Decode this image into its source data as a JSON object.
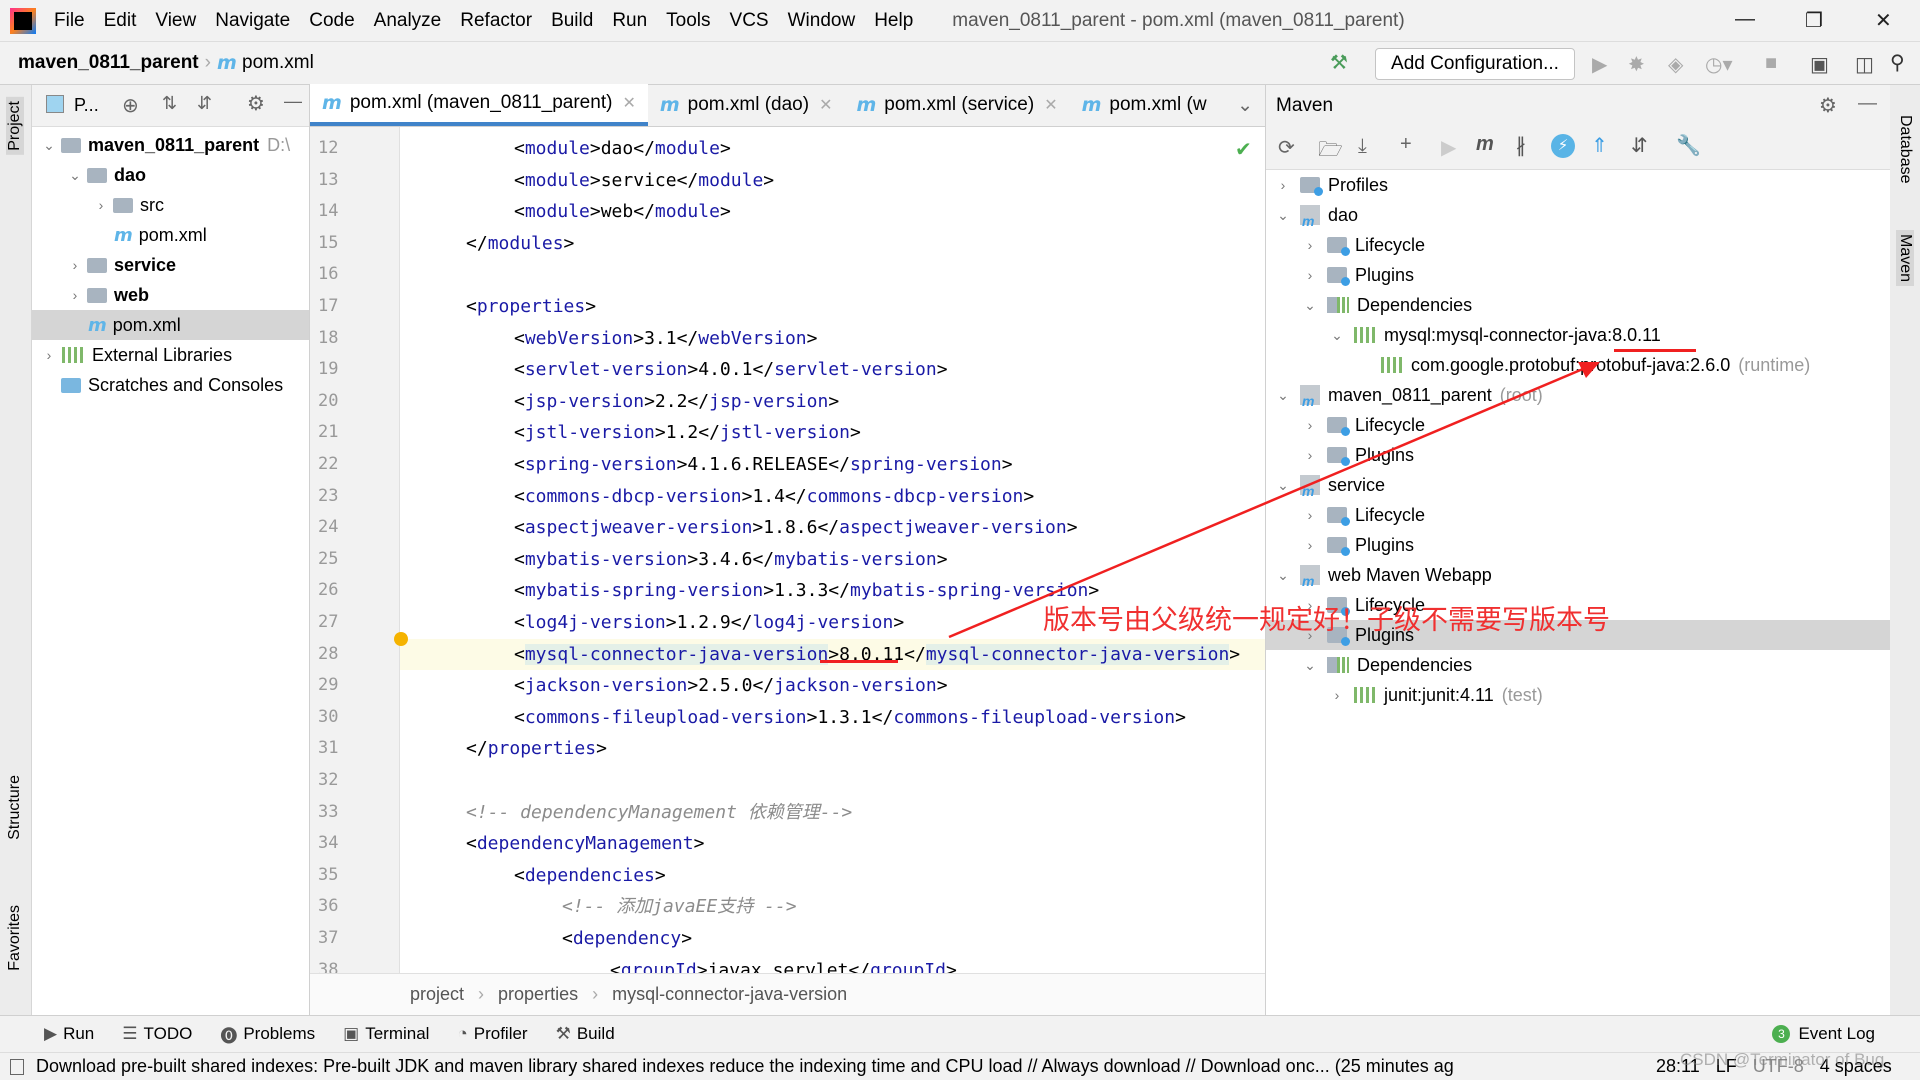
{
  "menubar": {
    "items": [
      "File",
      "Edit",
      "View",
      "Navigate",
      "Code",
      "Analyze",
      "Refactor",
      "Build",
      "Run",
      "Tools",
      "VCS",
      "Window",
      "Help"
    ],
    "title": "maven_0811_parent - pom.xml (maven_0811_parent)"
  },
  "navbar": {
    "project": "maven_0811_parent",
    "file": "pom.xml",
    "add_configuration": "Add Configuration..."
  },
  "left_stripe": {
    "project": "Project",
    "structure": "Structure",
    "favorites": "Favorites"
  },
  "right_stripe": {
    "database": "Database",
    "maven": "Maven"
  },
  "project_panel": {
    "title": "P...",
    "tree": [
      {
        "label": "maven_0811_parent",
        "suffix": "D:\\",
        "level": 0,
        "arrow": "v",
        "bold": true,
        "icon": "folder"
      },
      {
        "label": "dao",
        "level": 1,
        "arrow": "v",
        "bold": true,
        "icon": "folder"
      },
      {
        "label": "src",
        "level": 2,
        "arrow": ">",
        "icon": "folder"
      },
      {
        "label": "pom.xml",
        "level": 2,
        "arrow": "",
        "icon": "maven"
      },
      {
        "label": "service",
        "level": 1,
        "arrow": ">",
        "bold": true,
        "icon": "folder"
      },
      {
        "label": "web",
        "level": 1,
        "arrow": ">",
        "bold": true,
        "icon": "folder"
      },
      {
        "label": "pom.xml",
        "level": 1,
        "arrow": "",
        "icon": "maven",
        "selected": true
      },
      {
        "label": "External Libraries",
        "level": 0,
        "arrow": ">",
        "icon": "library"
      },
      {
        "label": "Scratches and Consoles",
        "level": 0,
        "arrow": "",
        "icon": "scratch"
      }
    ]
  },
  "editor": {
    "tabs": [
      {
        "label": "pom.xml (maven_0811_parent)",
        "active": true
      },
      {
        "label": "pom.xml (dao)"
      },
      {
        "label": "pom.xml (service)"
      },
      {
        "label": "pom.xml (w"
      }
    ],
    "current_line": 28,
    "lines": [
      {
        "n": 12,
        "i": 2,
        "s": [
          [
            "br",
            "<"
          ],
          [
            "tag",
            "module"
          ],
          [
            "br",
            ">"
          ],
          [
            "txt",
            "dao"
          ],
          [
            "br",
            "</"
          ],
          [
            "tag",
            "module"
          ],
          [
            "br",
            ">"
          ]
        ]
      },
      {
        "n": 13,
        "i": 2,
        "s": [
          [
            "br",
            "<"
          ],
          [
            "tag",
            "module"
          ],
          [
            "br",
            ">"
          ],
          [
            "txt",
            "service"
          ],
          [
            "br",
            "</"
          ],
          [
            "tag",
            "module"
          ],
          [
            "br",
            ">"
          ]
        ]
      },
      {
        "n": 14,
        "i": 2,
        "s": [
          [
            "br",
            "<"
          ],
          [
            "tag",
            "module"
          ],
          [
            "br",
            ">"
          ],
          [
            "txt",
            "web"
          ],
          [
            "br",
            "</"
          ],
          [
            "tag",
            "module"
          ],
          [
            "br",
            ">"
          ]
        ]
      },
      {
        "n": 15,
        "i": 1,
        "s": [
          [
            "br",
            "</"
          ],
          [
            "tag",
            "modules"
          ],
          [
            "br",
            ">"
          ]
        ]
      },
      {
        "n": 16,
        "i": 0,
        "s": []
      },
      {
        "n": 17,
        "i": 1,
        "s": [
          [
            "br",
            "<"
          ],
          [
            "tag",
            "properties"
          ],
          [
            "br",
            ">"
          ]
        ]
      },
      {
        "n": 18,
        "i": 2,
        "s": [
          [
            "br",
            "<"
          ],
          [
            "tag",
            "webVersion"
          ],
          [
            "br",
            ">"
          ],
          [
            "txt",
            "3.1"
          ],
          [
            "br",
            "</"
          ],
          [
            "tag",
            "webVersion"
          ],
          [
            "br",
            ">"
          ]
        ]
      },
      {
        "n": 19,
        "i": 2,
        "s": [
          [
            "br",
            "<"
          ],
          [
            "tag",
            "servlet-version"
          ],
          [
            "br",
            ">"
          ],
          [
            "txt",
            "4.0.1"
          ],
          [
            "br",
            "</"
          ],
          [
            "tag",
            "servlet-version"
          ],
          [
            "br",
            ">"
          ]
        ]
      },
      {
        "n": 20,
        "i": 2,
        "s": [
          [
            "br",
            "<"
          ],
          [
            "tag",
            "jsp-version"
          ],
          [
            "br",
            ">"
          ],
          [
            "txt",
            "2.2"
          ],
          [
            "br",
            "</"
          ],
          [
            "tag",
            "jsp-version"
          ],
          [
            "br",
            ">"
          ]
        ]
      },
      {
        "n": 21,
        "i": 2,
        "s": [
          [
            "br",
            "<"
          ],
          [
            "tag",
            "jstl-version"
          ],
          [
            "br",
            ">"
          ],
          [
            "txt",
            "1.2"
          ],
          [
            "br",
            "</"
          ],
          [
            "tag",
            "jstl-version"
          ],
          [
            "br",
            ">"
          ]
        ]
      },
      {
        "n": 22,
        "i": 2,
        "s": [
          [
            "br",
            "<"
          ],
          [
            "tag",
            "spring-version"
          ],
          [
            "br",
            ">"
          ],
          [
            "txt",
            "4.1.6.RELEASE"
          ],
          [
            "br",
            "</"
          ],
          [
            "tag",
            "spring-version"
          ],
          [
            "br",
            ">"
          ]
        ]
      },
      {
        "n": 23,
        "i": 2,
        "s": [
          [
            "br",
            "<"
          ],
          [
            "tag",
            "commons-dbcp-version"
          ],
          [
            "br",
            ">"
          ],
          [
            "txt",
            "1.4"
          ],
          [
            "br",
            "</"
          ],
          [
            "tag",
            "commons-dbcp-version"
          ],
          [
            "br",
            ">"
          ]
        ]
      },
      {
        "n": 24,
        "i": 2,
        "s": [
          [
            "br",
            "<"
          ],
          [
            "tag",
            "aspectjweaver-version"
          ],
          [
            "br",
            ">"
          ],
          [
            "txt",
            "1.8.6"
          ],
          [
            "br",
            "</"
          ],
          [
            "tag",
            "aspectjweaver-version"
          ],
          [
            "br",
            ">"
          ]
        ]
      },
      {
        "n": 25,
        "i": 2,
        "s": [
          [
            "br",
            "<"
          ],
          [
            "tag",
            "mybatis-version"
          ],
          [
            "br",
            ">"
          ],
          [
            "txt",
            "3.4.6"
          ],
          [
            "br",
            "</"
          ],
          [
            "tag",
            "mybatis-version"
          ],
          [
            "br",
            ">"
          ]
        ]
      },
      {
        "n": 26,
        "i": 2,
        "s": [
          [
            "br",
            "<"
          ],
          [
            "tag",
            "mybatis-spring-version"
          ],
          [
            "br",
            ">"
          ],
          [
            "txt",
            "1.3.3"
          ],
          [
            "br",
            "</"
          ],
          [
            "tag",
            "mybatis-spring-version"
          ],
          [
            "br",
            ">"
          ]
        ]
      },
      {
        "n": 27,
        "i": 2,
        "s": [
          [
            "br",
            "<"
          ],
          [
            "tag",
            "log4j-version"
          ],
          [
            "br",
            ">"
          ],
          [
            "txt",
            "1.2.9"
          ],
          [
            "br",
            "</"
          ],
          [
            "tag",
            "log4j-version"
          ],
          [
            "br",
            ">"
          ]
        ]
      },
      {
        "n": 28,
        "i": 2,
        "s": [
          [
            "br",
            "<"
          ],
          [
            "tag",
            "mysql-connector-java-version"
          ],
          [
            "br",
            ">"
          ],
          [
            "txt",
            "8.0.11"
          ],
          [
            "br",
            "</"
          ],
          [
            "tag",
            "mysql-connector-java-version"
          ],
          [
            "br",
            ">"
          ]
        ]
      },
      {
        "n": 29,
        "i": 2,
        "s": [
          [
            "br",
            "<"
          ],
          [
            "tag",
            "jackson-version"
          ],
          [
            "br",
            ">"
          ],
          [
            "txt",
            "2.5.0"
          ],
          [
            "br",
            "</"
          ],
          [
            "tag",
            "jackson-version"
          ],
          [
            "br",
            ">"
          ]
        ]
      },
      {
        "n": 30,
        "i": 2,
        "s": [
          [
            "br",
            "<"
          ],
          [
            "tag",
            "commons-fileupload-version"
          ],
          [
            "br",
            ">"
          ],
          [
            "txt",
            "1.3.1"
          ],
          [
            "br",
            "</"
          ],
          [
            "tag",
            "commons-fileupload-version"
          ],
          [
            "br",
            ">"
          ]
        ]
      },
      {
        "n": 31,
        "i": 1,
        "s": [
          [
            "br",
            "</"
          ],
          [
            "tag",
            "properties"
          ],
          [
            "br",
            ">"
          ]
        ]
      },
      {
        "n": 32,
        "i": 0,
        "s": []
      },
      {
        "n": 33,
        "i": 1,
        "s": [
          [
            "com",
            "<!-- dependencyManagement 依赖管理-->"
          ]
        ]
      },
      {
        "n": 34,
        "i": 1,
        "s": [
          [
            "br",
            "<"
          ],
          [
            "tag",
            "dependencyManagement"
          ],
          [
            "br",
            ">"
          ]
        ]
      },
      {
        "n": 35,
        "i": 2,
        "s": [
          [
            "br",
            "<"
          ],
          [
            "tag",
            "dependencies"
          ],
          [
            "br",
            ">"
          ]
        ]
      },
      {
        "n": 36,
        "i": 3,
        "s": [
          [
            "com",
            "<!-- 添加javaEE支持 -->"
          ]
        ]
      },
      {
        "n": 37,
        "i": 3,
        "s": [
          [
            "br",
            "<"
          ],
          [
            "tag",
            "dependency"
          ],
          [
            "br",
            ">"
          ]
        ]
      },
      {
        "n": 38,
        "i": 4,
        "s": [
          [
            "br",
            "<"
          ],
          [
            "tag",
            "groupId"
          ],
          [
            "br",
            ">"
          ],
          [
            "txt",
            "javax.servlet"
          ],
          [
            "br",
            "</"
          ],
          [
            "tag",
            "groupId"
          ],
          [
            "br",
            ">"
          ]
        ]
      }
    ],
    "breadcrumbs": [
      "project",
      "properties",
      "mysql-connector-java-version"
    ]
  },
  "maven_panel": {
    "title": "Maven",
    "tree": [
      {
        "label": "Profiles",
        "level": 0,
        "arrow": ">",
        "icon": "profiles"
      },
      {
        "label": "dao",
        "level": 0,
        "arrow": "v",
        "icon": "module"
      },
      {
        "label": "Lifecycle",
        "level": 1,
        "arrow": ">",
        "icon": "folder"
      },
      {
        "label": "Plugins",
        "level": 1,
        "arrow": ">",
        "icon": "folder"
      },
      {
        "label": "Dependencies",
        "level": 1,
        "arrow": "v",
        "icon": "deps"
      },
      {
        "label": "mysql:mysql-connector-java:8.0.11",
        "level": 2,
        "arrow": "v",
        "icon": "lib"
      },
      {
        "label": "com.google.protobuf:protobuf-java:2.6.0",
        "suffix": "(runtime)",
        "level": 3,
        "arrow": "",
        "icon": "lib"
      },
      {
        "label": "maven_0811_parent",
        "suffix": "(root)",
        "level": 0,
        "arrow": "v",
        "icon": "module"
      },
      {
        "label": "Lifecycle",
        "level": 1,
        "arrow": ">",
        "icon": "folder"
      },
      {
        "label": "Plugins",
        "level": 1,
        "arrow": ">",
        "icon": "folder"
      },
      {
        "label": "service",
        "level": 0,
        "arrow": "v",
        "icon": "module"
      },
      {
        "label": "Lifecycle",
        "level": 1,
        "arrow": ">",
        "icon": "folder"
      },
      {
        "label": "Plugins",
        "level": 1,
        "arrow": ">",
        "icon": "folder"
      },
      {
        "label": "web Maven Webapp",
        "level": 0,
        "arrow": "v",
        "icon": "module"
      },
      {
        "label": "Lifecycle",
        "level": 1,
        "arrow": ">",
        "icon": "folder"
      },
      {
        "label": "Plugins",
        "level": 1,
        "arrow": ">",
        "icon": "folder",
        "selected": true
      },
      {
        "label": "Dependencies",
        "level": 1,
        "arrow": "v",
        "icon": "deps"
      },
      {
        "label": "junit:junit:4.11",
        "suffix": "(test)",
        "level": 2,
        "arrow": ">",
        "icon": "lib"
      }
    ]
  },
  "annotation": {
    "text": "版本号由父级统一规定好！子级不需要写版本号",
    "color": "#f03030"
  },
  "bottom_tools": [
    "Run",
    "TODO",
    "Problems",
    "Terminal",
    "Profiler",
    "Build"
  ],
  "event_log": {
    "label": "Event Log",
    "count": "3"
  },
  "status": {
    "message": "Download pre-built shared indexes: Pre-built JDK and maven library shared indexes reduce the indexing time and CPU load // Always download // Download onc... (25 minutes ag",
    "position": "28:11",
    "line_sep": "LF",
    "encoding": "UTF-8",
    "indent": "4 spaces",
    "watermark": "CSDN @Terminator of Bug"
  },
  "colors": {
    "accent": "#4083c9",
    "tag": "#1a1aa6",
    "comment": "#8c8c8c"
  }
}
